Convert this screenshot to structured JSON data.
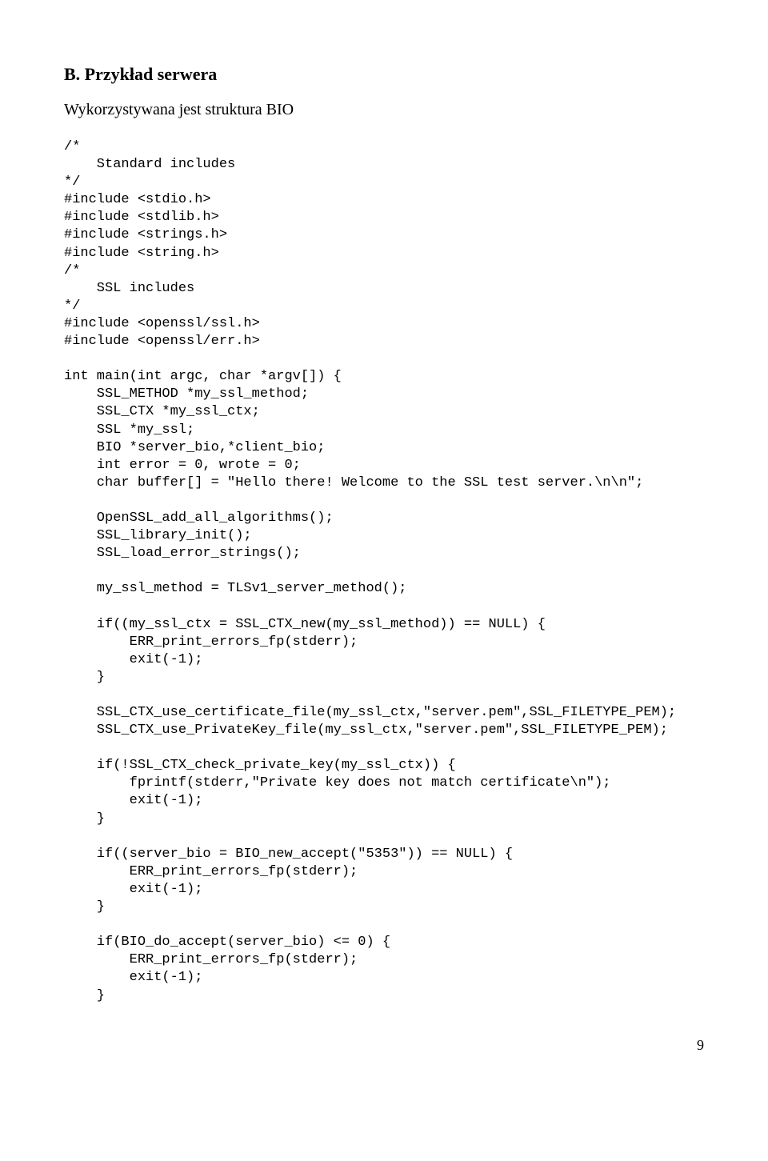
{
  "heading": "B. Przykład serwera",
  "subheading": "Wykorzystywana jest struktura BIO",
  "code": "/*\n    Standard includes\n*/\n#include <stdio.h>\n#include <stdlib.h>\n#include <strings.h>\n#include <string.h>\n/*\n    SSL includes\n*/\n#include <openssl/ssl.h>\n#include <openssl/err.h>\n\nint main(int argc, char *argv[]) {\n    SSL_METHOD *my_ssl_method;\n    SSL_CTX *my_ssl_ctx;\n    SSL *my_ssl;\n    BIO *server_bio,*client_bio;\n    int error = 0, wrote = 0;\n    char buffer[] = \"Hello there! Welcome to the SSL test server.\\n\\n\";\n\n    OpenSSL_add_all_algorithms();\n    SSL_library_init();\n    SSL_load_error_strings();\n\n    my_ssl_method = TLSv1_server_method();\n\n    if((my_ssl_ctx = SSL_CTX_new(my_ssl_method)) == NULL) {\n        ERR_print_errors_fp(stderr);\n        exit(-1);\n    }\n\n    SSL_CTX_use_certificate_file(my_ssl_ctx,\"server.pem\",SSL_FILETYPE_PEM);\n    SSL_CTX_use_PrivateKey_file(my_ssl_ctx,\"server.pem\",SSL_FILETYPE_PEM);\n\n    if(!SSL_CTX_check_private_key(my_ssl_ctx)) {\n        fprintf(stderr,\"Private key does not match certificate\\n\");\n        exit(-1);\n    }\n\n    if((server_bio = BIO_new_accept(\"5353\")) == NULL) {\n        ERR_print_errors_fp(stderr);\n        exit(-1);\n    }\n\n    if(BIO_do_accept(server_bio) <= 0) {\n        ERR_print_errors_fp(stderr);\n        exit(-1);\n    }",
  "pageNumber": "9"
}
